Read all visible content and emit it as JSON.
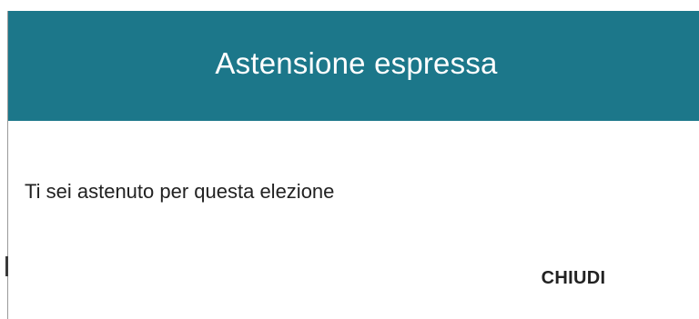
{
  "dialog": {
    "title": "Astensione espressa",
    "message": "Ti sei astenuto per questa elezione",
    "close_label": "CHIUDI"
  },
  "colors": {
    "header_background": "#1c778a",
    "header_text": "#ffffff",
    "body_text": "#222222",
    "dialog_background": "#ffffff"
  }
}
